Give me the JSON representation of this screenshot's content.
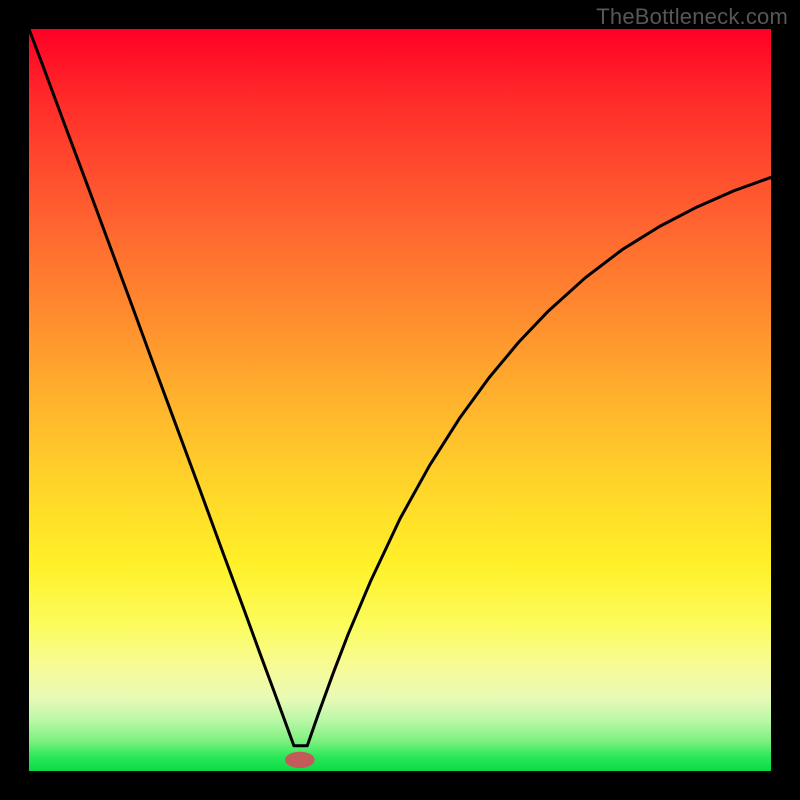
{
  "watermark": "TheBottleneck.com",
  "chart_data": {
    "type": "line",
    "title": "",
    "xlabel": "",
    "ylabel": "",
    "xlim": [
      0,
      100
    ],
    "ylim": [
      0,
      100
    ],
    "gradient_stops": [
      {
        "pos": 0,
        "color": "#ff0025"
      },
      {
        "pos": 10,
        "color": "#ff2d2a"
      },
      {
        "pos": 25,
        "color": "#ff6030"
      },
      {
        "pos": 38,
        "color": "#ff8a2e"
      },
      {
        "pos": 50,
        "color": "#ffb22d"
      },
      {
        "pos": 62,
        "color": "#ffd629"
      },
      {
        "pos": 72,
        "color": "#fff028"
      },
      {
        "pos": 80,
        "color": "#fcfc5a"
      },
      {
        "pos": 86,
        "color": "#f7fb96"
      },
      {
        "pos": 90,
        "color": "#e9fab5"
      },
      {
        "pos": 93,
        "color": "#bdf8a9"
      },
      {
        "pos": 96,
        "color": "#7cf07e"
      },
      {
        "pos": 98,
        "color": "#2de85a"
      },
      {
        "pos": 100,
        "color": "#08db45"
      }
    ],
    "series": [
      {
        "name": "curve",
        "stroke": "#000000",
        "stroke_width": 3,
        "x": [
          0.0,
          2.0,
          5.0,
          8.0,
          11.0,
          14.0,
          17.0,
          20.0,
          23.0,
          26.0,
          29.0,
          31.0,
          33.0,
          34.5,
          35.7,
          37.5,
          39.0,
          41.0,
          43.0,
          46.0,
          50.0,
          54.0,
          58.0,
          62.0,
          66.0,
          70.0,
          75.0,
          80.0,
          85.0,
          90.0,
          95.0,
          100.0
        ],
        "y": [
          100.0,
          94.7,
          86.6,
          78.6,
          70.5,
          62.4,
          54.2,
          46.1,
          38.0,
          29.8,
          21.7,
          16.2,
          10.8,
          6.7,
          3.4,
          3.4,
          7.7,
          13.2,
          18.4,
          25.5,
          34.0,
          41.2,
          47.5,
          53.0,
          57.8,
          62.0,
          66.5,
          70.3,
          73.4,
          76.0,
          78.2,
          80.0
        ]
      }
    ],
    "marker": {
      "cx": 36.5,
      "cy": 1.5,
      "rx": 2.0,
      "ry": 1.1,
      "fill": "#c45a5a"
    }
  }
}
